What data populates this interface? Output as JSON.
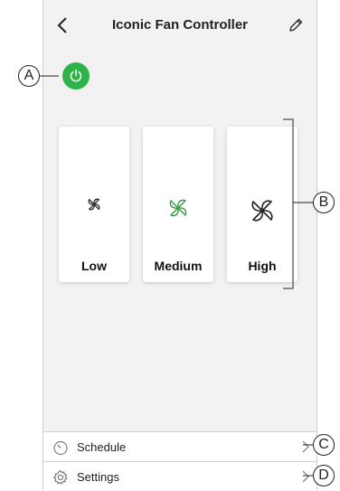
{
  "header": {
    "title": "Iconic Fan Controller",
    "back_icon": "chevron-left-icon",
    "edit_icon": "pencil-icon"
  },
  "power": {
    "icon": "power-icon",
    "state_color": "#2eb34a"
  },
  "speeds": [
    {
      "label": "Low",
      "icon": "fan-icon",
      "selected": false
    },
    {
      "label": "Medium",
      "icon": "fan-icon",
      "selected": true
    },
    {
      "label": "High",
      "icon": "fan-icon",
      "selected": false
    }
  ],
  "accent": "#3a9a4a",
  "menu": {
    "schedule": {
      "label": "Schedule",
      "icon": "clock-icon"
    },
    "settings": {
      "label": "Settings",
      "icon": "gear-icon"
    }
  },
  "callouts": {
    "a": "A",
    "b": "B",
    "c": "C",
    "d": "D"
  }
}
